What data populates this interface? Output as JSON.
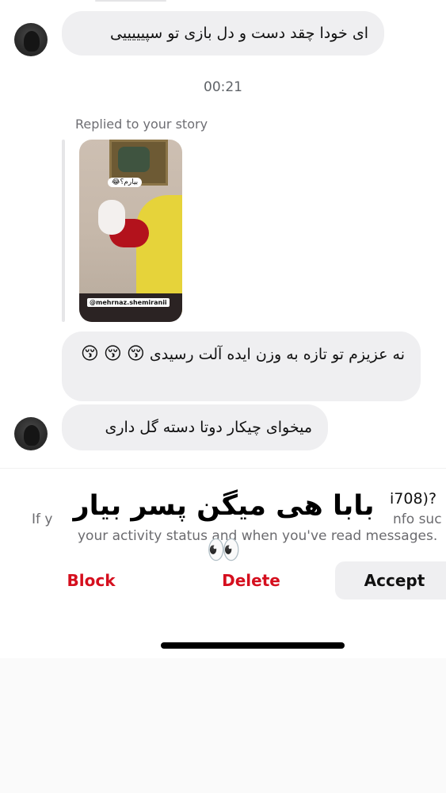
{
  "messages": [
    {
      "text": "ای خودا چقد دست و دل بازی تو سپیییییی"
    },
    {
      "text": "نه عزیزم تو تازه به وزن ایده آلت رسیدی"
    },
    {
      "text": "میخوای چیکار دوتا دسته گل داری"
    }
  ],
  "emoji": {
    "kissing": "😚"
  },
  "timestamp": "00:21",
  "reply_label": "Replied to your story",
  "story": {
    "sticker": "بیارم؟😂",
    "tag": "@mehrnaz.shemiranii"
  },
  "overlay": {
    "caption": "بابا هی میگن پسر بیار",
    "eyes": "👀"
  },
  "request_sheet": {
    "partial_top_right": "i708)?",
    "partial_left": "If y",
    "partial_right": "nfo suc",
    "activity_line": "your activity status and when you've read messages."
  },
  "actions": {
    "block": "Block",
    "delete": "Delete",
    "accept": "Accept"
  },
  "colors": {
    "destructive": "#d50f1e",
    "bubble": "#efeff1",
    "text": "#111111"
  }
}
